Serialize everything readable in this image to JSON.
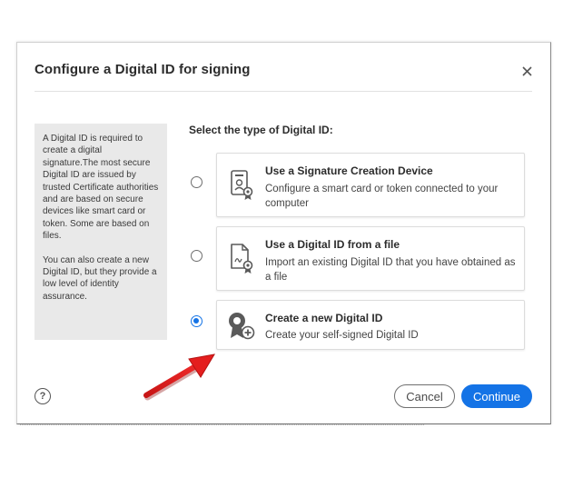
{
  "dialog": {
    "title": "Configure a Digital ID for signing",
    "close_icon": "close-icon"
  },
  "info": {
    "paragraph1": "A Digital ID is required to create a digital signature.The most secure Digital ID are issued by trusted Certificate authorities and are based on secure devices like smart card or token. Some are based on files.",
    "paragraph2": "You can also create a new Digital ID, but they provide a low level of identity assurance."
  },
  "prompt": "Select the type of Digital ID:",
  "options": [
    {
      "title": "Use a Signature Creation Device",
      "description": "Configure a smart card or token connected to your computer",
      "icon": "certificate-device-icon",
      "selected": false
    },
    {
      "title": "Use a Digital ID from a file",
      "description": "Import an existing Digital ID that you have obtained as a file",
      "icon": "certificate-file-icon",
      "selected": false
    },
    {
      "title": "Create a new Digital ID",
      "description": "Create your self-signed Digital ID",
      "icon": "new-digital-id-icon",
      "selected": true
    }
  ],
  "footer": {
    "help_label": "?",
    "cancel_label": "Cancel",
    "continue_label": "Continue"
  },
  "colors": {
    "accent": "#1473e6",
    "annotation_arrow": "#e41e1e",
    "info_panel_bg": "#e9e9e9"
  }
}
